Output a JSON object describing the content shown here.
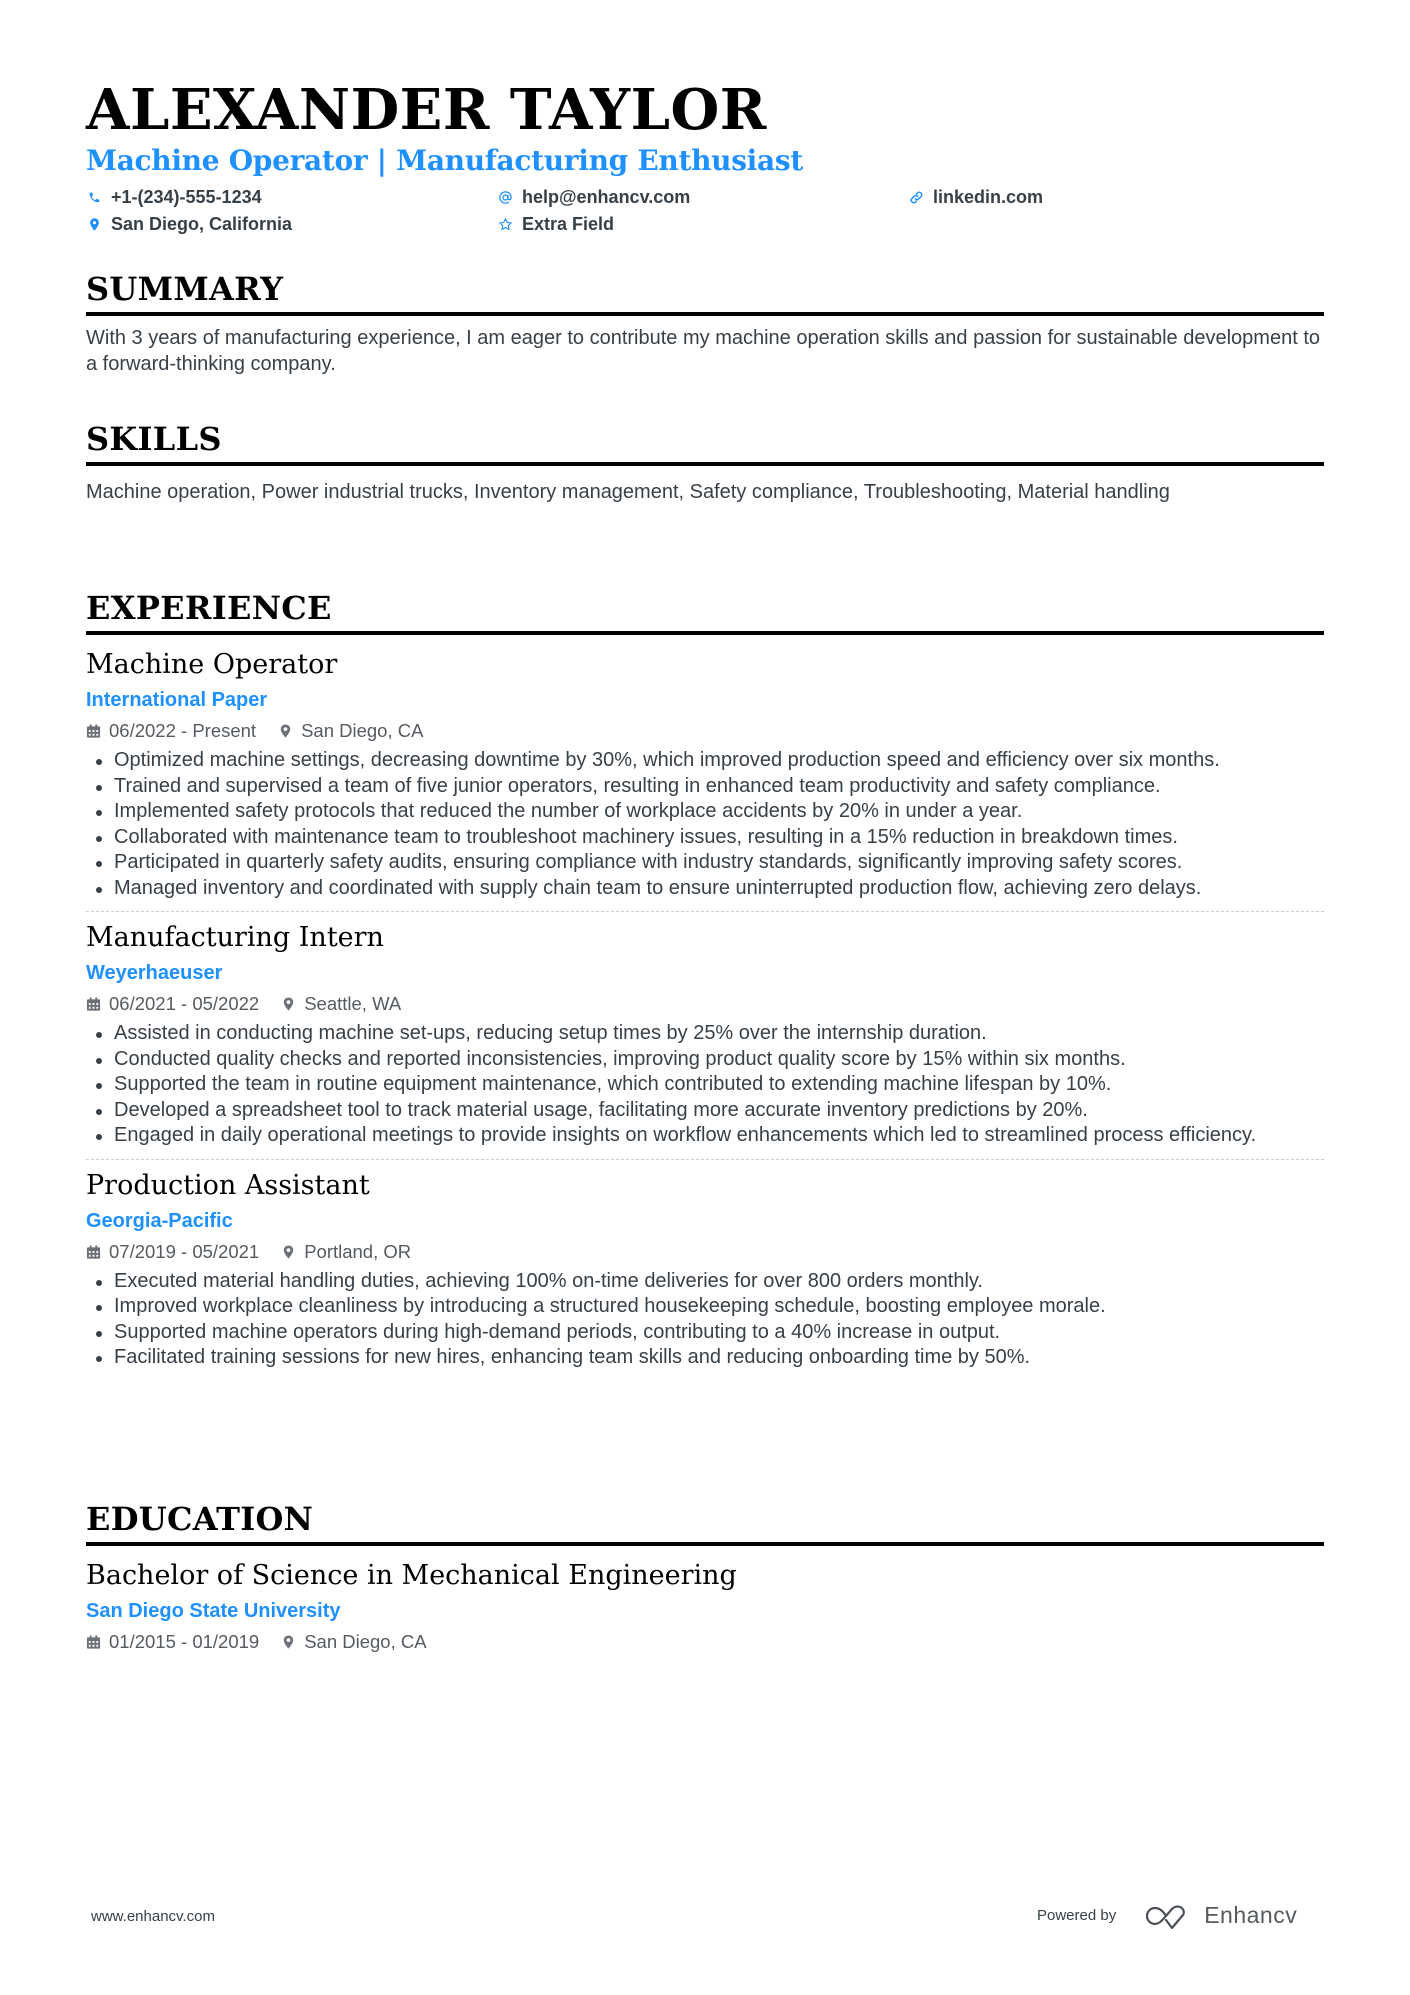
{
  "header": {
    "name": "ALEXANDER TAYLOR",
    "subtitle": "Machine Operator | Manufacturing Enthusiast",
    "contacts": [
      {
        "icon": "phone-icon",
        "text": "+1-(234)-555-1234"
      },
      {
        "icon": "at-icon",
        "text": "help@enhancv.com"
      },
      {
        "icon": "link-icon",
        "text": "linkedin.com"
      },
      {
        "icon": "location-pin-icon",
        "text": "San Diego, California"
      },
      {
        "icon": "star-icon",
        "text": "Extra Field"
      }
    ]
  },
  "colors": {
    "accent": "#1E90FF",
    "text": "#384047",
    "heading": "#000000"
  },
  "summary": {
    "title": "SUMMARY",
    "text": "With 3 years of manufacturing experience, I am eager to contribute my machine operation skills and passion for sustainable development to a forward-thinking company."
  },
  "skills": {
    "title": "SKILLS",
    "text": "Machine operation, Power industrial trucks, Inventory management, Safety compliance, Troubleshooting, Material handling"
  },
  "experience": {
    "title": "EXPERIENCE",
    "items": [
      {
        "role": "Machine Operator",
        "company": "International Paper",
        "dates": "06/2022 - Present",
        "location": "San Diego, CA",
        "bullets": [
          "Optimized machine settings, decreasing downtime by 30%, which improved production speed and efficiency over six months.",
          "Trained and supervised a team of five junior operators, resulting in enhanced team productivity and safety compliance.",
          "Implemented safety protocols that reduced the number of workplace accidents by 20% in under a year.",
          "Collaborated with maintenance team to troubleshoot machinery issues, resulting in a 15% reduction in breakdown times.",
          "Participated in quarterly safety audits, ensuring compliance with industry standards, significantly improving safety scores.",
          "Managed inventory and coordinated with supply chain team to ensure uninterrupted production flow, achieving zero delays."
        ]
      },
      {
        "role": "Manufacturing Intern",
        "company": "Weyerhaeuser",
        "dates": "06/2021 - 05/2022",
        "location": "Seattle, WA",
        "bullets": [
          "Assisted in conducting machine set-ups, reducing setup times by 25% over the internship duration.",
          "Conducted quality checks and reported inconsistencies, improving product quality score by 15% within six months.",
          "Supported the team in routine equipment maintenance, which contributed to extending machine lifespan by 10%.",
          "Developed a spreadsheet tool to track material usage, facilitating more accurate inventory predictions by 20%.",
          "Engaged in daily operational meetings to provide insights on workflow enhancements which led to streamlined process efficiency."
        ]
      },
      {
        "role": "Production Assistant",
        "company": "Georgia-Pacific",
        "dates": "07/2019 - 05/2021",
        "location": "Portland, OR",
        "bullets": [
          "Executed material handling duties, achieving 100% on-time deliveries for over 800 orders monthly.",
          "Improved workplace cleanliness by introducing a structured housekeeping schedule, boosting employee morale.",
          "Supported machine operators during high-demand periods, contributing to a 40% increase in output.",
          "Facilitated training sessions for new hires, enhancing team skills and reducing onboarding time by 50%."
        ]
      }
    ]
  },
  "education": {
    "title": "EDUCATION",
    "items": [
      {
        "degree": "Bachelor of Science in Mechanical Engineering",
        "school": "San Diego State University",
        "dates": "01/2015 - 01/2019",
        "location": "San Diego, CA"
      }
    ]
  },
  "footer": {
    "website": "www.enhancv.com",
    "powered_by": "Powered by",
    "brand": "Enhancv"
  }
}
